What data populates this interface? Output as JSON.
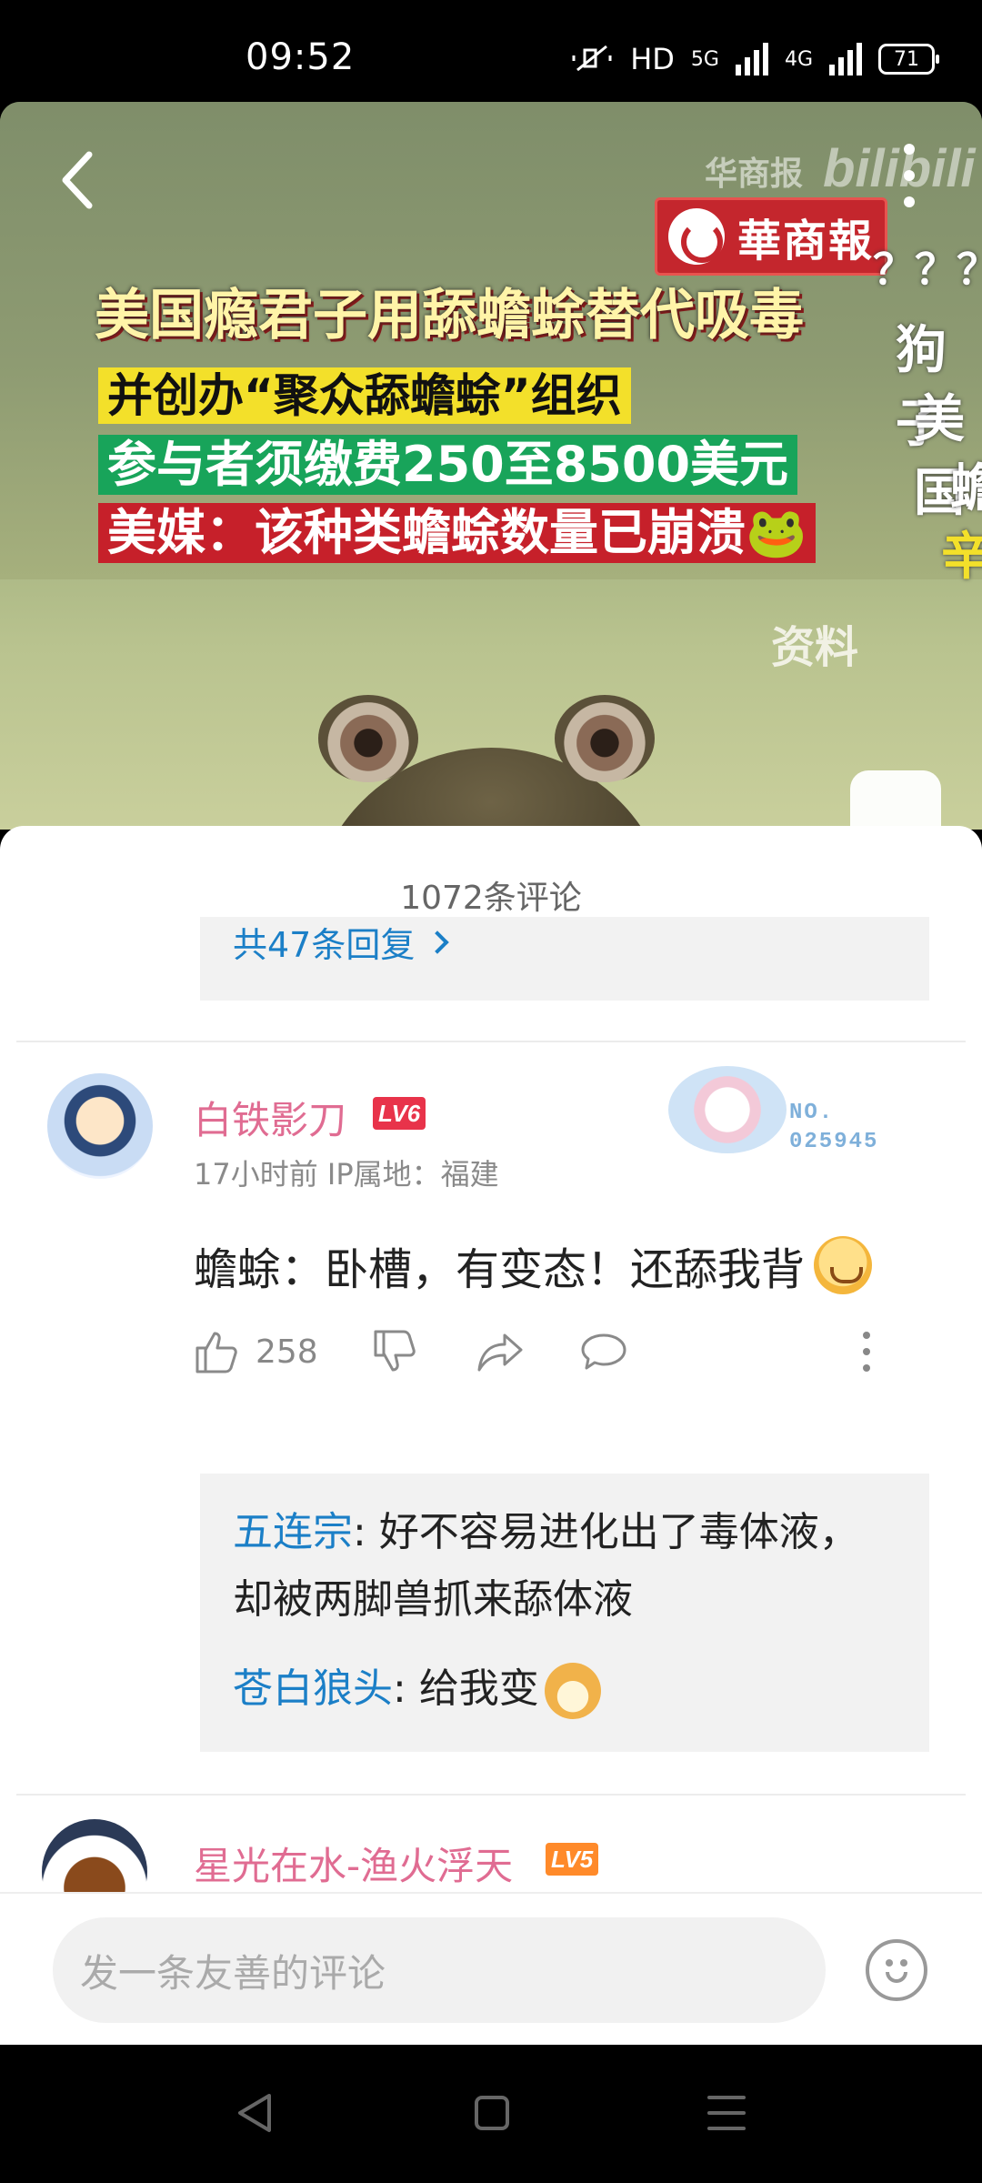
{
  "status": {
    "time": "09:52",
    "hd": "HD",
    "net1": "5G",
    "net2": "4G",
    "battery": "71"
  },
  "video": {
    "watermark_text": "华商报",
    "watermark_logo": "bilibili",
    "brand": "華商報",
    "headlines": [
      "美国瘾君子用舔蟾蜍替代吸毒",
      "并创办“聚众舔蟾蜍”组织",
      "参与者须缴费250至8500美元",
      "美媒：该种类蟾蜍数量已崩溃🐸"
    ],
    "side_text": [
      "？？？",
      "狗子",
      "美国",
      "蟾",
      "辛"
    ],
    "overlay_label": "资料"
  },
  "comments": {
    "count_title": "1072条评论",
    "prev_reply_link": "共47条回复",
    "items": [
      {
        "username": "白铁影刀",
        "level": "LV6",
        "badge_no_label": "NO.",
        "badge_no_value": "025945",
        "meta": "17小时前  IP属地：福建",
        "text": "蟾蜍：卧槽，有变态！还舔我背",
        "likes": "258",
        "replies": [
          {
            "user": "五连宗",
            "sep": ": ",
            "text": "好不容易进化出了毒体液，却被两脚兽抓来舔体液"
          },
          {
            "user": "苍白狼头",
            "sep": ": ",
            "text": "给我变"
          }
        ]
      },
      {
        "username": "星光在水-渔火浮天",
        "level": "LV5"
      }
    ]
  },
  "input": {
    "placeholder": "发一条友善的评论"
  },
  "colors": {
    "accent_pink": "#e06c92",
    "link_blue": "#1b7fc7",
    "lv6": "#e8334a",
    "lv5": "#ff8a2a"
  }
}
